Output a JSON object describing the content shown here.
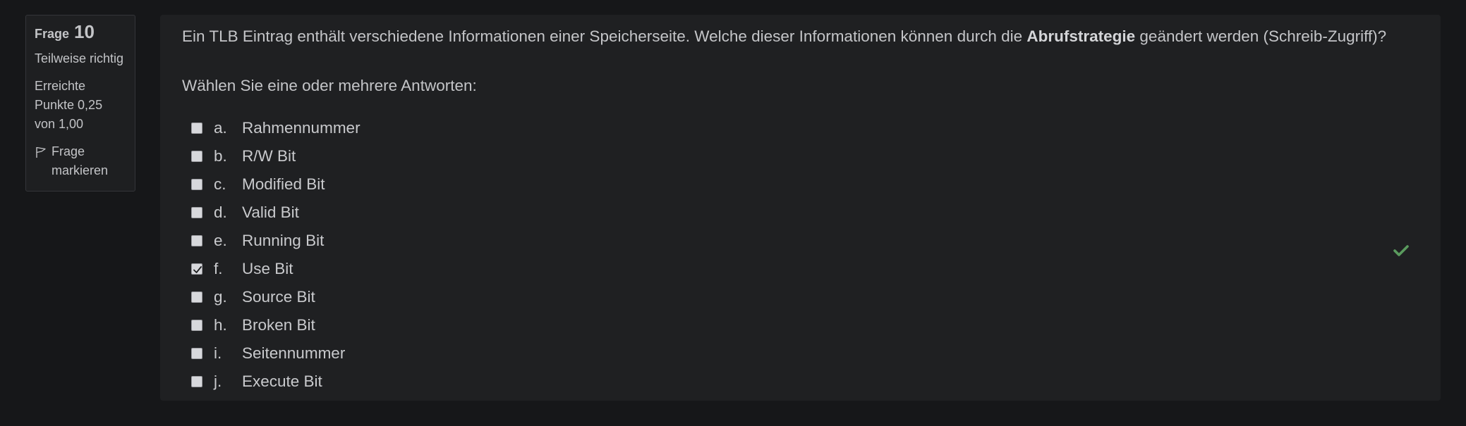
{
  "info": {
    "question_label": "Frage",
    "question_number": "10",
    "state": "Teilweise richtig",
    "grade": "Erreichte Punkte 0,25 von 1,00",
    "flag_label": "Frage markieren"
  },
  "question": {
    "text_before": "Ein TLB Eintrag enthält verschiedene Informationen einer Speicherseite. Welche dieser Informationen können durch die ",
    "text_bold": "Abrufstrategie",
    "text_after": " geändert werden (Schreib-Zugriff)?",
    "prompt": "Wählen Sie eine oder mehrere Antworten:"
  },
  "answers": [
    {
      "letter": "a.",
      "text": "Rahmennummer",
      "checked": false
    },
    {
      "letter": "b.",
      "text": "R/W Bit",
      "checked": false
    },
    {
      "letter": "c.",
      "text": "Modified Bit",
      "checked": false
    },
    {
      "letter": "d.",
      "text": "Valid Bit",
      "checked": false
    },
    {
      "letter": "e.",
      "text": "Running Bit",
      "checked": false
    },
    {
      "letter": "f.",
      "text": "Use Bit",
      "checked": true,
      "feedback": "correct"
    },
    {
      "letter": "g.",
      "text": "Source Bit",
      "checked": false
    },
    {
      "letter": "h.",
      "text": "Broken Bit",
      "checked": false
    },
    {
      "letter": "i.",
      "text": "Seitennummer",
      "checked": false
    },
    {
      "letter": "j.",
      "text": "Execute Bit",
      "checked": false
    }
  ],
  "colors": {
    "correct": "#5a9b5e"
  }
}
